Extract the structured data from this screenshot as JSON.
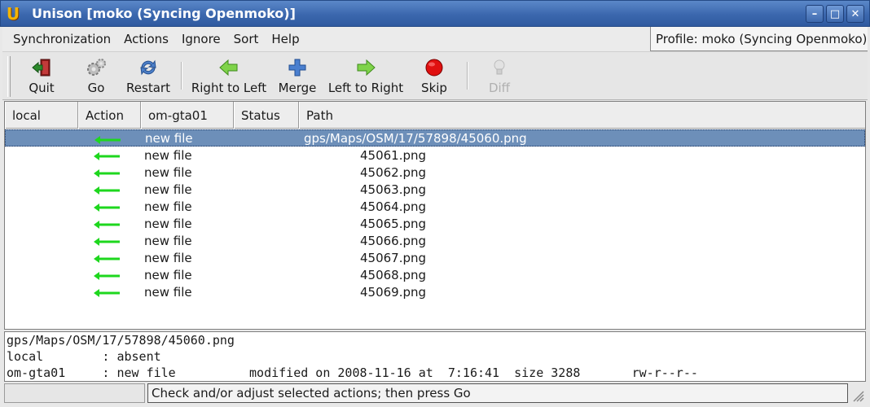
{
  "window": {
    "title": "Unison [moko (Syncing Openmoko)]",
    "app_icon": "U",
    "controls": [
      {
        "name": "minimize-icon",
        "glyph": "–"
      },
      {
        "name": "maximize-icon",
        "glyph": "□"
      },
      {
        "name": "close-icon",
        "glyph": "✕"
      }
    ]
  },
  "menu": {
    "items": [
      "Synchronization",
      "Actions",
      "Ignore",
      "Sort",
      "Help"
    ],
    "profile": "Profile: moko (Syncing Openmoko)"
  },
  "toolbar": {
    "buttons": [
      {
        "label": "Quit",
        "icon": "exit-icon"
      },
      {
        "label": "Go",
        "icon": "gears-icon"
      },
      {
        "label": "Restart",
        "icon": "refresh-icon"
      },
      {
        "label": "Right to Left",
        "icon": "arrow-left-icon"
      },
      {
        "label": "Merge",
        "icon": "plus-icon"
      },
      {
        "label": "Left to Right",
        "icon": "arrow-right-icon"
      },
      {
        "label": "Skip",
        "icon": "stop-icon"
      },
      {
        "label": "Diff",
        "icon": "lightbulb-icon",
        "disabled": true
      }
    ]
  },
  "table": {
    "columns": [
      "local",
      "Action",
      "om-gta01",
      "Status",
      "Path"
    ],
    "rows": [
      {
        "action": "left-arrow",
        "remote": "new file",
        "path": "gps/Maps/OSM/17/57898/45060.png"
      },
      {
        "action": "left-arrow",
        "remote": "new file",
        "path": "45061.png"
      },
      {
        "action": "left-arrow",
        "remote": "new file",
        "path": "45062.png"
      },
      {
        "action": "left-arrow",
        "remote": "new file",
        "path": "45063.png"
      },
      {
        "action": "left-arrow",
        "remote": "new file",
        "path": "45064.png"
      },
      {
        "action": "left-arrow",
        "remote": "new file",
        "path": "45065.png"
      },
      {
        "action": "left-arrow",
        "remote": "new file",
        "path": "45066.png"
      },
      {
        "action": "left-arrow",
        "remote": "new file",
        "path": "45067.png"
      },
      {
        "action": "left-arrow",
        "remote": "new file",
        "path": "45068.png"
      },
      {
        "action": "left-arrow",
        "remote": "new file",
        "path": "45069.png"
      }
    ],
    "selected_row": 0,
    "action_color": "#1ed71e",
    "selection_color": "#6d8fb9"
  },
  "details": {
    "path": "gps/Maps/OSM/17/57898/45060.png",
    "local_line": "local        : absent",
    "remote_line": "om-gta01     : new file          modified on 2008-11-16 at  7:16:41  size 3288       rw-r--r--"
  },
  "status": {
    "message": "Check and/or adjust selected actions; then press Go"
  }
}
